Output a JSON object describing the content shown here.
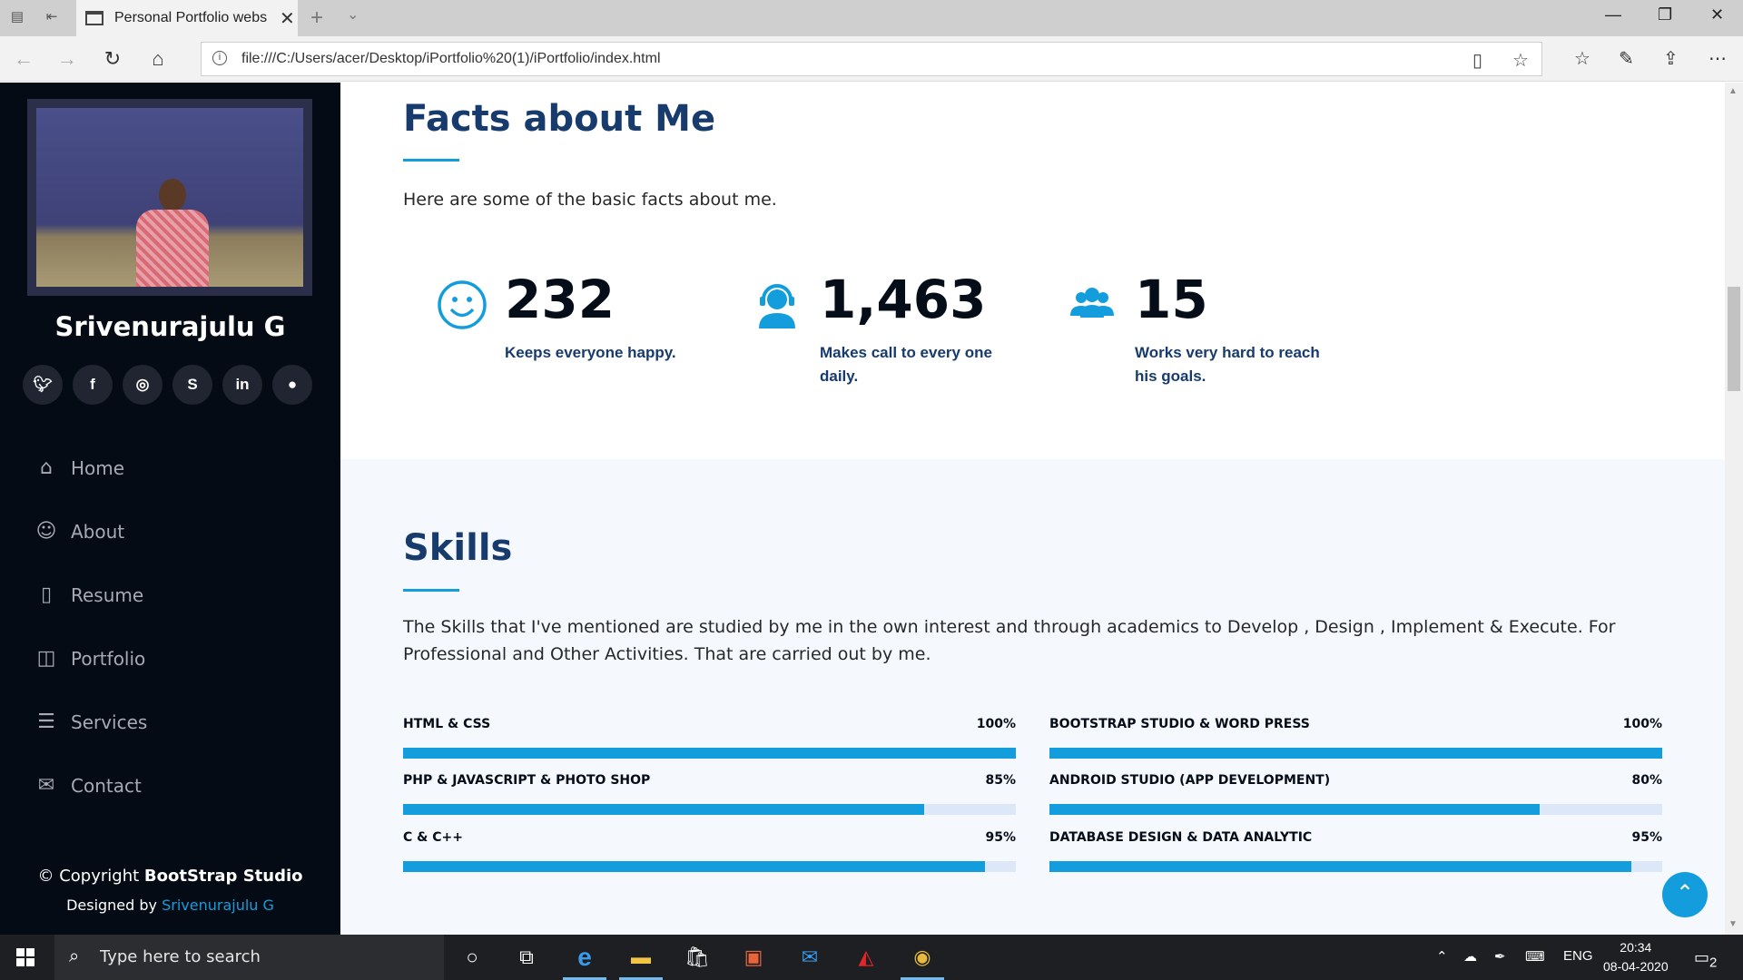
{
  "browser": {
    "tab_title": "Personal Portfolio webs",
    "url": "file:///C:/Users/acer/Desktop/iPortfolio%20(1)/iPortfolio/index.html"
  },
  "sidebar": {
    "name": "Srivenurajulu G",
    "socials": [
      "twitter",
      "facebook",
      "instagram",
      "skype",
      "linkedin",
      "github"
    ],
    "nav": [
      {
        "label": "Home",
        "icon": "home-icon"
      },
      {
        "label": "About",
        "icon": "user-icon"
      },
      {
        "label": "Resume",
        "icon": "file-icon"
      },
      {
        "label": "Portfolio",
        "icon": "book-icon"
      },
      {
        "label": "Services",
        "icon": "server-icon"
      },
      {
        "label": "Contact",
        "icon": "envelope-icon"
      }
    ],
    "copyright_prefix": "© Copyright ",
    "copyright_brand": "BootStrap Studio",
    "designed_prefix": "Designed by ",
    "designed_by": "Srivenurajulu G"
  },
  "facts": {
    "title": "Facts about Me",
    "description": "Here are some of the basic facts about me.",
    "items": [
      {
        "number": "232",
        "text": "Keeps everyone happy."
      },
      {
        "number": "1,463",
        "text": "Makes call to every one daily."
      },
      {
        "number": "15",
        "text": "Works very hard to reach his goals."
      }
    ]
  },
  "skills": {
    "title": "Skills",
    "description": "The Skills that I've mentioned are studied by me in the own interest and through academics to Develop , Design , Implement & Execute. For Professional and Other Activities. That are carried out by me.",
    "items": [
      {
        "name": "HTML & CSS",
        "value": "100%",
        "level": 100
      },
      {
        "name": "BOOTSTRAP STUDIO & WORD PRESS",
        "value": "100%",
        "level": 100
      },
      {
        "name": "PHP & JAVASCRIPT & PHOTO SHOP",
        "value": "85%",
        "level": 85
      },
      {
        "name": "ANDROID STUDIO (APP DEVELOPMENT)",
        "value": "80%",
        "level": 80
      },
      {
        "name": "C & C++",
        "value": "95%",
        "level": 95
      },
      {
        "name": "DATABASE DESIGN & DATA ANALYTIC",
        "value": "95%",
        "level": 95
      }
    ]
  },
  "taskbar": {
    "search_placeholder": "Type here to search",
    "language": "ENG",
    "time": "20:34",
    "date": "08-04-2020",
    "notifications": "2"
  },
  "colors": {
    "accent": "#149ddd",
    "heading": "#173b6c",
    "sidebar_bg": "#040b14"
  }
}
